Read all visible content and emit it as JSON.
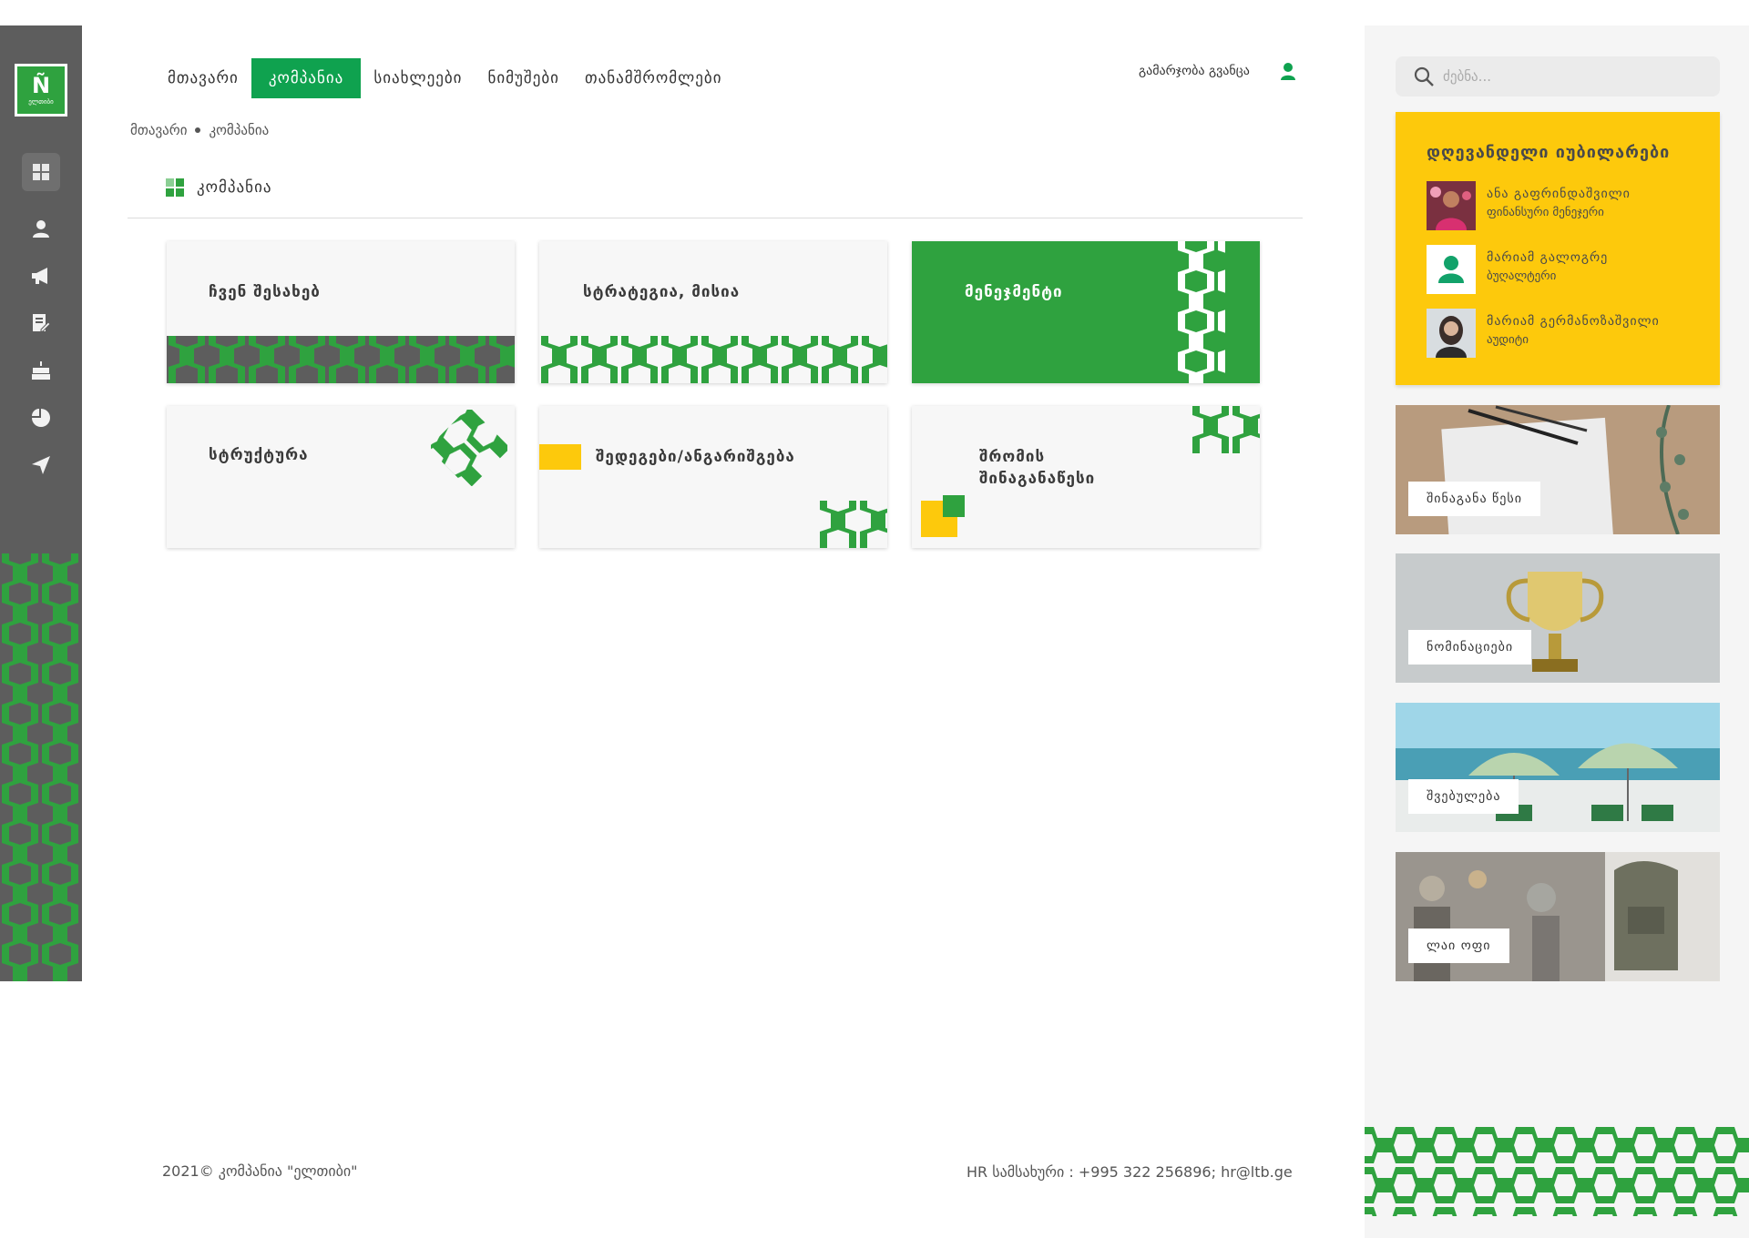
{
  "logo": {
    "mark": "Ñ",
    "text": "ელთიბი"
  },
  "nav": {
    "items": [
      {
        "label": "მთავარი"
      },
      {
        "label": "კომპანია"
      },
      {
        "label": "სიახლეები"
      },
      {
        "label": "ნიმუშები"
      },
      {
        "label": "თანამშრომლები"
      }
    ],
    "greeting": "გამარჯობა გვანცა"
  },
  "breadcrumb": {
    "home": "მთავარი",
    "current": "კომპანია"
  },
  "page_title": "კომპანია",
  "cards": [
    {
      "label": "ჩვენ შესახებ"
    },
    {
      "label": "სტრატეგია, მისია"
    },
    {
      "label": "მენეჯმენტი"
    },
    {
      "label": "სტრუქტურა"
    },
    {
      "label": "შედეგები/ანგარიშგება"
    },
    {
      "label": "შრომის შინაგანაწესი"
    }
  ],
  "footer": {
    "copyright": "2021© კომპანია \"ელთიბი\"",
    "contact": "HR სამსახური : +995 322 256896; hr@ltb.ge"
  },
  "search": {
    "placeholder": "ძებნა..."
  },
  "birthdays": {
    "title": "დღევანდელი იუბილარები",
    "people": [
      {
        "name": "ანა გაფრინდაშვილი",
        "role": "ფინანსური მენეჯერი"
      },
      {
        "name": "მარიამ გალოგრე",
        "role": "ბუღალტერი"
      },
      {
        "name": "მარიამ გერმანოზაშვილი",
        "role": "აუდიტი"
      }
    ]
  },
  "image_cards": [
    {
      "label": "შინაგანა წესი"
    },
    {
      "label": "ნომინაციები"
    },
    {
      "label": "შვებულება"
    },
    {
      "label": "ლაი ოფი"
    }
  ],
  "colors": {
    "brand_green": "#2fa23f",
    "nav_active": "#0fa24f",
    "yellow": "#fdc90c",
    "sidebar": "#5d5d5d"
  },
  "icons": [
    "dashboard-icon",
    "user-icon",
    "megaphone-icon",
    "document-edit-icon",
    "cake-icon",
    "pie-chart-icon",
    "send-icon",
    "search-icon"
  ]
}
